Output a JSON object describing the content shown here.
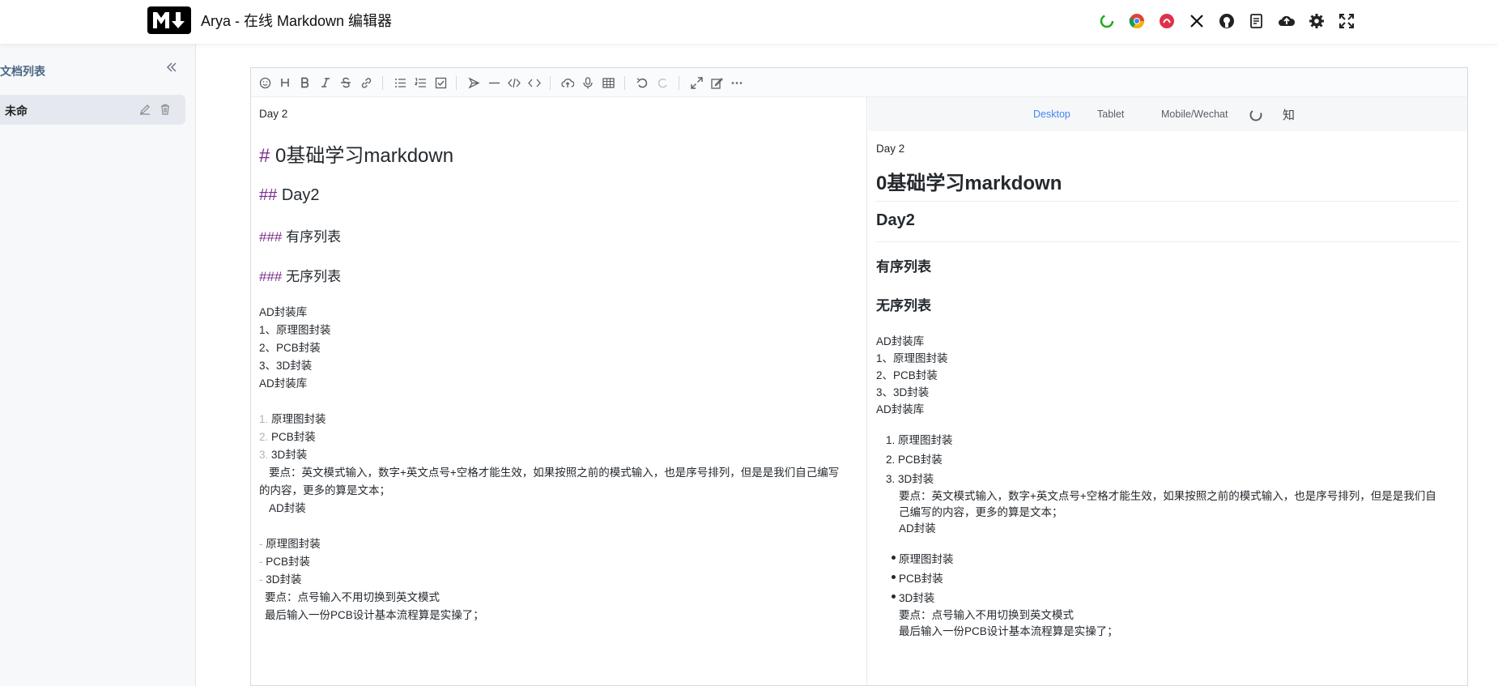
{
  "header": {
    "title": "Arya - 在线 Markdown 编辑器",
    "icons": [
      "sync-icon",
      "chrome-icon",
      "lucky-icon",
      "x-icon",
      "github-icon",
      "notes-icon",
      "cloud-upload-icon",
      "settings-icon",
      "fullscreen-icon"
    ]
  },
  "sidebar": {
    "title": "文档列表",
    "doc": "未命"
  },
  "source": {
    "day": "Day 2",
    "h1_hash": "#",
    "h1_text": "0基础学习markdown",
    "h2_hash": "##",
    "h2_text": "Day2",
    "h3a_hash": "###",
    "h3a_text": "有序列表",
    "h3b_hash": "###",
    "h3b_text": "无序列表",
    "plain": [
      "AD封装库",
      "1、原理图封装",
      "2、PCB封装",
      "3、3D封装",
      "AD封装库"
    ],
    "ol_nums": [
      "1.",
      "2.",
      "3."
    ],
    "ol_items": [
      "原理图封装",
      "PCB封装",
      "3D封装"
    ],
    "note1_a": "要点：英文模式输入，数字+英文点号+空格才能生效，如果按照之前的模式输入，也是序号排列，但是是我们自己编写",
    "note1_b": "的内容，更多的算是文本；",
    "note1_c": "AD封装",
    "ul_marks": [
      "-",
      "-",
      "-"
    ],
    "ul_items": [
      "原理图封装",
      "PCB封装",
      "3D封装"
    ],
    "note2_a": "要点：点号输入不用切换到英文模式",
    "note2_b": "最后输入一份PCB设计基本流程算是实操了；"
  },
  "preview": {
    "modes": [
      "Desktop",
      "Tablet",
      "Mobile/Wechat"
    ],
    "zhi": "知",
    "day": "Day 2",
    "h1": "0基础学习markdown",
    "h2": "Day2",
    "h3a": "有序列表",
    "h3b": "无序列表",
    "plain": [
      "AD封装库",
      "1、原理图封装",
      "2、PCB封装",
      "3、3D封装",
      "AD封装库"
    ],
    "ol": [
      "1. 原理图封装",
      "2. PCB封装",
      "3. 3D封装"
    ],
    "note1_a": "要点：英文模式输入，数字+英文点号+空格才能生效，如果按照之前的模式输入，也是序号排列，但是是我们自",
    "note1_b": "己编写的内容，更多的算是文本；",
    "note1_c": "AD封装",
    "ul": [
      "原理图封装",
      "PCB封装",
      "3D封装"
    ],
    "note2_a": "要点：点号输入不用切换到英文模式",
    "note2_b": "最后输入一份PCB设计基本流程算是实操了；"
  }
}
